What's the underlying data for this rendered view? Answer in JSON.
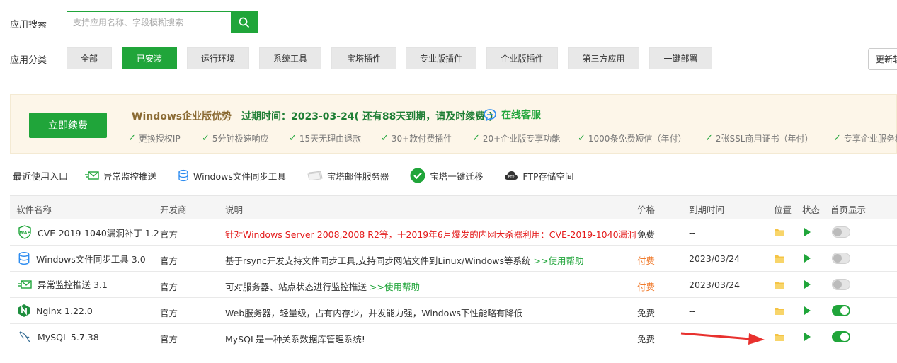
{
  "search": {
    "label": "应用搜索",
    "placeholder": "支持应用名称、字段模糊搜索"
  },
  "category": {
    "label": "应用分类",
    "items": [
      "全部",
      "已安装",
      "运行环境",
      "系统工具",
      "宝塔插件",
      "专业版插件",
      "企业版插件",
      "第三方应用",
      "一键部署"
    ],
    "active": "已安装",
    "update_label": "更新软"
  },
  "promo": {
    "renew_label": "立即续费",
    "title": "Windows企业版优势",
    "expire_text": "过期时间：2023-03-24( 还有88天到期，请及时续费 )",
    "service_label": "在线客服",
    "features": [
      "更换授权IP",
      "5分钟极速响应",
      "15天无理由退款",
      "30+款付费插件",
      "20+企业版专享功能",
      "1000条免费短信（年付）",
      "2张SSL商用证书（年付）",
      "专享企业服务群"
    ]
  },
  "recent": {
    "label": "最近使用入口",
    "items": [
      {
        "label": "异常监控推送",
        "icon": "monitor-push-icon"
      },
      {
        "label": "Windows文件同步工具",
        "icon": "database-sync-icon"
      },
      {
        "label": "宝塔邮件服务器",
        "icon": "mail-server-icon"
      },
      {
        "label": "宝塔一键迁移",
        "icon": "check-circle-icon"
      },
      {
        "label": "FTP存储空间",
        "icon": "ftp-cloud-icon"
      }
    ]
  },
  "table": {
    "headers": [
      "软件名称",
      "开发商",
      "说明",
      "价格",
      "到期时间",
      "位置",
      "状态",
      "首页显示"
    ],
    "rows": [
      {
        "name": "CVE-2019-1040漏洞补丁 1.2",
        "icon": "waf-shield-icon",
        "vendor": "官方",
        "desc": "针对Windows Server 2008,2008 R2等，于2019年6月爆发的内网大杀器利用：CVE-2019-1040漏洞",
        "desc_help": "",
        "price": "免费",
        "expire": "--",
        "home": false
      },
      {
        "name": "Windows文件同步工具 3.0",
        "icon": "database-sync-icon",
        "vendor": "官方",
        "desc": "基于rsync开发支持文件同步工具,支持同步网站文件到Linux/Windows等系统",
        "desc_help": ">>使用帮助",
        "price": "付费",
        "expire": "2023/03/24",
        "home": false
      },
      {
        "name": "异常监控推送 3.1",
        "icon": "monitor-push-icon",
        "vendor": "官方",
        "desc": "可对服务器、站点状态进行监控推送",
        "desc_help": ">>使用帮助",
        "price": "付费",
        "expire": "2023/03/24",
        "home": false
      },
      {
        "name": "Nginx 1.22.0",
        "icon": "nginx-icon",
        "vendor": "官方",
        "desc": "Web服务器，轻量级，占有内存少，并发能力强，Windows下性能略有降低",
        "desc_help": "",
        "price": "免费",
        "expire": "--",
        "home": true
      },
      {
        "name": "MySQL 5.7.38",
        "icon": "mysql-dolphin-icon",
        "vendor": "官方",
        "desc": "MySQL是一种关系数据库管理系统!",
        "desc_help": "",
        "price": "免费",
        "expire": "--",
        "home": true
      }
    ]
  },
  "colors": {
    "accent": "#20a53a",
    "danger": "#e41b1b",
    "paid": "#f07a2b",
    "folder": "#f5c445",
    "arrow": "#e8312e"
  }
}
